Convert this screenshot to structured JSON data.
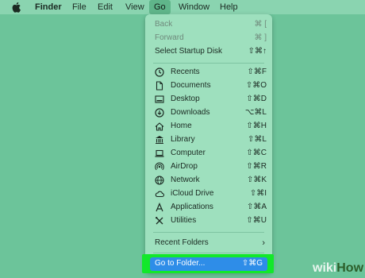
{
  "menubar": {
    "apple_icon": "apple-logo-icon",
    "items": [
      {
        "label": "Finder"
      },
      {
        "label": "File"
      },
      {
        "label": "Edit"
      },
      {
        "label": "View"
      },
      {
        "label": "Go"
      },
      {
        "label": "Window"
      },
      {
        "label": "Help"
      }
    ]
  },
  "go_menu": {
    "history": [
      {
        "label": "Back",
        "shortcut": "⌘ [",
        "enabled": false
      },
      {
        "label": "Forward",
        "shortcut": "⌘ ]",
        "enabled": false
      },
      {
        "label": "Select Startup Disk",
        "shortcut": "⇧⌘↑",
        "enabled": true
      }
    ],
    "places": [
      {
        "label": "Recents",
        "shortcut": "⇧⌘F",
        "icon": "clock-icon"
      },
      {
        "label": "Documents",
        "shortcut": "⇧⌘O",
        "icon": "document-icon"
      },
      {
        "label": "Desktop",
        "shortcut": "⇧⌘D",
        "icon": "desktop-icon"
      },
      {
        "label": "Downloads",
        "shortcut": "⌥⌘L",
        "icon": "download-icon"
      },
      {
        "label": "Home",
        "shortcut": "⇧⌘H",
        "icon": "home-icon"
      },
      {
        "label": "Library",
        "shortcut": "⇧⌘L",
        "icon": "library-icon"
      },
      {
        "label": "Computer",
        "shortcut": "⇧⌘C",
        "icon": "laptop-icon"
      },
      {
        "label": "AirDrop",
        "shortcut": "⇧⌘R",
        "icon": "airdrop-icon"
      },
      {
        "label": "Network",
        "shortcut": "⇧⌘K",
        "icon": "globe-icon"
      },
      {
        "label": "iCloud Drive",
        "shortcut": "⇧⌘I",
        "icon": "cloud-icon"
      },
      {
        "label": "Applications",
        "shortcut": "⇧⌘A",
        "icon": "applications-icon"
      },
      {
        "label": "Utilities",
        "shortcut": "⇧⌘U",
        "icon": "utilities-icon"
      }
    ],
    "recent_folders": {
      "label": "Recent Folders",
      "icon": "chevron-right-icon"
    },
    "go_to_folder": {
      "label": "Go to Folder...",
      "shortcut": "⇧⌘G",
      "selected": true
    }
  },
  "watermark": {
    "part1": "wiki",
    "part2": "How"
  },
  "colors": {
    "desktop": "#6cc49a",
    "menubar": "#8ad4b0",
    "menu": "#9ee0be",
    "selection": "#2e8de8",
    "highlight_box": "#12e82a"
  }
}
